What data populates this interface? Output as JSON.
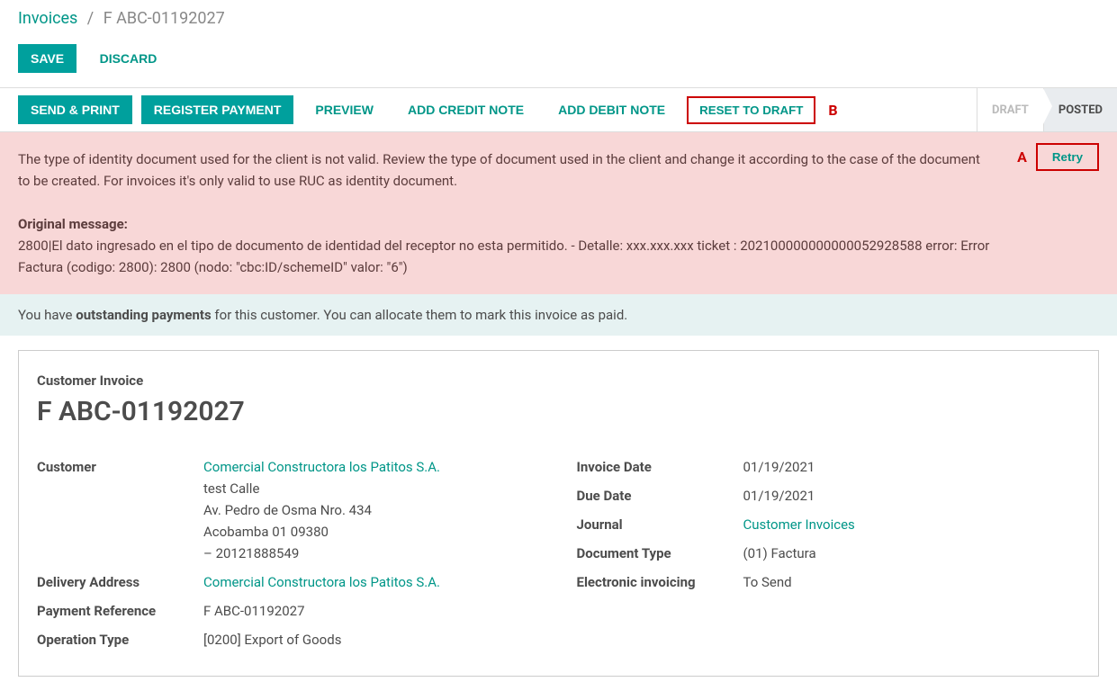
{
  "breadcrumb": {
    "root": "Invoices",
    "sep": "/",
    "current": "F ABC-01192027"
  },
  "top_actions": {
    "save": "SAVE",
    "discard": "DISCARD"
  },
  "action_bar": {
    "send_print": "SEND & PRINT",
    "register_payment": "REGISTER PAYMENT",
    "preview": "PREVIEW",
    "add_credit_note": "ADD CREDIT NOTE",
    "add_debit_note": "ADD DEBIT NOTE",
    "reset_to_draft": "RESET TO DRAFT",
    "marker_b": "B"
  },
  "status": {
    "draft": "DRAFT",
    "posted": "POSTED"
  },
  "error_alert": {
    "line1": "The type of identity document used for the client is not valid. Review the type of document used in the client and change it according to the case of the document to be created. For invoices it's only valid to use RUC as identity document.",
    "original_label": "Original message:",
    "original_body": "2800|El dato ingresado en el tipo de documento de identidad del receptor no esta permitido. - Detalle: xxx.xxx.xxx ticket : 202100000000000052928588 error: Error Factura (codigo: 2800): 2800 (nodo: \"cbc:ID/schemeID\" valor: \"6\")",
    "marker_a": "A",
    "retry": "Retry"
  },
  "info_alert": {
    "pre": "You have ",
    "bold": "outstanding payments",
    "post": " for this customer. You can allocate them to mark this invoice as paid."
  },
  "sheet": {
    "subtitle": "Customer Invoice",
    "title": "F ABC-01192027",
    "left": {
      "customer_label": "Customer",
      "customer_link": "Comercial Constructora los Patitos S.A.",
      "addr_line1": "test Calle",
      "addr_line2": "Av. Pedro de Osma Nro. 434",
      "addr_line3": "Acobamba 01 09380",
      "addr_line4": "– 20121888549",
      "delivery_label": "Delivery Address",
      "delivery_link": "Comercial Constructora los Patitos S.A.",
      "payref_label": "Payment Reference",
      "payref_value": "F ABC-01192027",
      "optype_label": "Operation Type",
      "optype_value": "[0200] Export of Goods"
    },
    "right": {
      "invdate_label": "Invoice Date",
      "invdate_value": "01/19/2021",
      "duedate_label": "Due Date",
      "duedate_value": "01/19/2021",
      "journal_label": "Journal",
      "journal_link": "Customer Invoices",
      "doctype_label": "Document Type",
      "doctype_value": "(01) Factura",
      "einv_label": "Electronic invoicing",
      "einv_value": "To Send"
    }
  }
}
